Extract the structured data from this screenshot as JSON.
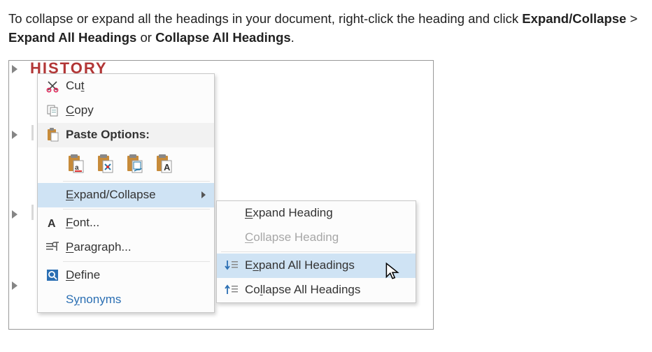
{
  "intro": {
    "t1": "To collapse or expand all the headings in your document, right-click the heading and click ",
    "b1": "Expand/Collapse",
    "sep1": " > ",
    "b2": "Expand All Headings",
    "sep2": " or ",
    "b3": "Collapse All Headings",
    "end": "."
  },
  "heading": "HISTORY",
  "menu1": {
    "cut": "Cut",
    "copy": "Copy",
    "paste_label": "Paste Options:",
    "expand_collapse": "Expand/Collapse",
    "font": "Font...",
    "paragraph": "Paragraph...",
    "define": "Define",
    "synonyms": "Synonyms"
  },
  "menu2": {
    "expand_heading": "Expand Heading",
    "collapse_heading": "Collapse Heading",
    "expand_all": "Expand All Headings",
    "collapse_all": "Collapse All Headings"
  }
}
